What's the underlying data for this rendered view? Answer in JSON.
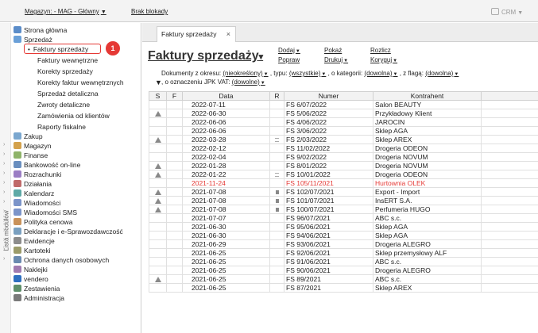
{
  "topbar": {
    "warehouse_label": "Magazyn: - MAG - Główny",
    "no_locks_label": "Brak blokady",
    "crm_label": "CRM"
  },
  "sidebar": {
    "vertical_label": "Lista modułów",
    "items": [
      {
        "label": "Strona główna",
        "icon": "home-icon"
      },
      {
        "label": "Sprzedaż",
        "icon": "sales-icon"
      },
      {
        "label": "Zakup",
        "icon": "purchase-icon"
      },
      {
        "label": "Magazyn",
        "icon": "warehouse-icon"
      },
      {
        "label": "Finanse",
        "icon": "finance-icon"
      },
      {
        "label": "Bankowość on-line",
        "icon": "bank-icon"
      },
      {
        "label": "Rozrachunki",
        "icon": "settlement-icon"
      },
      {
        "label": "Działania",
        "icon": "actions-icon"
      },
      {
        "label": "Kalendarz",
        "icon": "calendar-icon"
      },
      {
        "label": "Wiadomości",
        "icon": "messages-icon"
      },
      {
        "label": "Wiadomości SMS",
        "icon": "sms-icon"
      },
      {
        "label": "Polityka cenowa",
        "icon": "pricing-icon"
      },
      {
        "label": "Deklaracje i e-Sprawozdawczość",
        "icon": "declarations-icon"
      },
      {
        "label": "Ewidencje",
        "icon": "records-icon"
      },
      {
        "label": "Kartoteki",
        "icon": "files-icon"
      },
      {
        "label": "Ochrona danych osobowych",
        "icon": "privacy-icon"
      },
      {
        "label": "Naklejki",
        "icon": "stickers-icon"
      },
      {
        "label": "vendero",
        "icon": "vendero-icon"
      },
      {
        "label": "Zestawienia",
        "icon": "reports-icon"
      },
      {
        "label": "Administracja",
        "icon": "admin-icon"
      }
    ],
    "sales_sub": [
      "Faktury sprzedaży",
      "Faktury wewnętrzne",
      "Korekty sprzedaży",
      "Korekty faktur wewnętrznych",
      "Sprzedaż detaliczna",
      "Zwroty detaliczne",
      "Zamówienia od klientów",
      "Raporty fiskalne"
    ],
    "marker": "1"
  },
  "tab": {
    "label": "Faktury sprzedaży",
    "close": "×"
  },
  "header": {
    "title": "Faktury sprzedaży",
    "actions": {
      "add": "Dodaj",
      "fix": "Popraw",
      "show": "Pokaż",
      "print": "Drukuj",
      "settle": "Rozlicz",
      "correct": "Koryguj"
    },
    "filters": {
      "period_label": "Dokumenty z okresu:",
      "period_value": "(nieokreślony)",
      "type_label": ", typu:",
      "type_value": "(wszystkie)",
      "category_label": ", o kategorii:",
      "category_value": "(dowolna)",
      "flag_label": ", z flagą:",
      "flag_value": "(dowolna)",
      "jpk_label": ", o oznaczeniu JPK VAT:",
      "jpk_value": "(dowolne)"
    }
  },
  "table": {
    "columns": [
      "S",
      "F",
      "Data",
      "R",
      "Numer",
      "Kontrahent"
    ],
    "rows": [
      {
        "s": "",
        "f": "",
        "date": "2022-07-11",
        "r": "",
        "number": "FS 6/07/2022",
        "client": "Salon BEAUTY",
        "red": false
      },
      {
        "s": "warn",
        "f": "",
        "date": "2022-06-30",
        "r": "",
        "number": "FS 5/06/2022",
        "client": "Przykładowy Klient",
        "red": false
      },
      {
        "s": "",
        "f": "",
        "date": "2022-06-06",
        "r": "",
        "number": "FS 4/06/2022",
        "client": "JAROCIN",
        "red": false
      },
      {
        "s": "",
        "f": "",
        "date": "2022-06-06",
        "r": "",
        "number": "FS 3/06/2022",
        "client": "Sklep AGA",
        "red": false
      },
      {
        "s": "warn",
        "f": "",
        "date": "2022-03-28",
        "r": "lines",
        "number": "FS 2/03/2022",
        "client": "Sklep AREX",
        "red": false
      },
      {
        "s": "",
        "f": "",
        "date": "2022-02-12",
        "r": "",
        "number": "FS 11/02/2022",
        "client": "Drogeria ODEON",
        "red": false
      },
      {
        "s": "",
        "f": "",
        "date": "2022-02-04",
        "r": "",
        "number": "FS 9/02/2022",
        "client": "Drogeria NOVUM",
        "red": false
      },
      {
        "s": "warn",
        "f": "",
        "date": "2022-01-28",
        "r": "",
        "number": "FS 8/01/2022",
        "client": "Drogeria NOVUM",
        "red": false
      },
      {
        "s": "warn",
        "f": "",
        "date": "2022-01-22",
        "r": "lines",
        "number": "FS 10/01/2022",
        "client": "Drogeria ODEON",
        "red": false
      },
      {
        "s": "",
        "f": "",
        "date": "2021-11-24",
        "r": "",
        "number": "FS 105/11/2021",
        "client": "Hurtownia OLEK",
        "red": true
      },
      {
        "s": "warn",
        "f": "",
        "date": "2021-07-08",
        "r": "sq",
        "number": "FS 102/07/2021",
        "client": "Export - Import",
        "red": false
      },
      {
        "s": "warn",
        "f": "",
        "date": "2021-07-08",
        "r": "sq",
        "number": "FS 101/07/2021",
        "client": "InsERT S.A.",
        "red": false
      },
      {
        "s": "warn",
        "f": "",
        "date": "2021-07-08",
        "r": "sq",
        "number": "FS 100/07/2021",
        "client": "Perfumeria HUGO",
        "red": false
      },
      {
        "s": "",
        "f": "",
        "date": "2021-07-07",
        "r": "",
        "number": "FS 96/07/2021",
        "client": "ABC s.c.",
        "red": false
      },
      {
        "s": "",
        "f": "",
        "date": "2021-06-30",
        "r": "",
        "number": "FS 95/06/2021",
        "client": "Sklep AGA",
        "red": false
      },
      {
        "s": "",
        "f": "",
        "date": "2021-06-30",
        "r": "",
        "number": "FS 94/06/2021",
        "client": "Sklep AGA",
        "red": false
      },
      {
        "s": "",
        "f": "",
        "date": "2021-06-29",
        "r": "",
        "number": "FS 93/06/2021",
        "client": "Drogeria ALEGRO",
        "red": false
      },
      {
        "s": "",
        "f": "",
        "date": "2021-06-25",
        "r": "",
        "number": "FS 92/06/2021",
        "client": "Sklep przemysłowy ALF",
        "red": false
      },
      {
        "s": "",
        "f": "",
        "date": "2021-06-25",
        "r": "",
        "number": "FS 91/06/2021",
        "client": "ABC s.c.",
        "red": false
      },
      {
        "s": "",
        "f": "",
        "date": "2021-06-25",
        "r": "",
        "number": "FS 90/06/2021",
        "client": "Drogeria ALEGRO",
        "red": false
      },
      {
        "s": "warn",
        "f": "",
        "date": "2021-06-25",
        "r": "",
        "number": "FS 89/2021",
        "client": "ABC s.c.",
        "red": false
      },
      {
        "s": "",
        "f": "",
        "date": "2021-06-25",
        "r": "",
        "number": "FS 87/2021",
        "client": "Sklep AREX",
        "red": false
      }
    ]
  },
  "colors": {
    "accent_red": "#e53935",
    "red_row": "#e53935"
  }
}
